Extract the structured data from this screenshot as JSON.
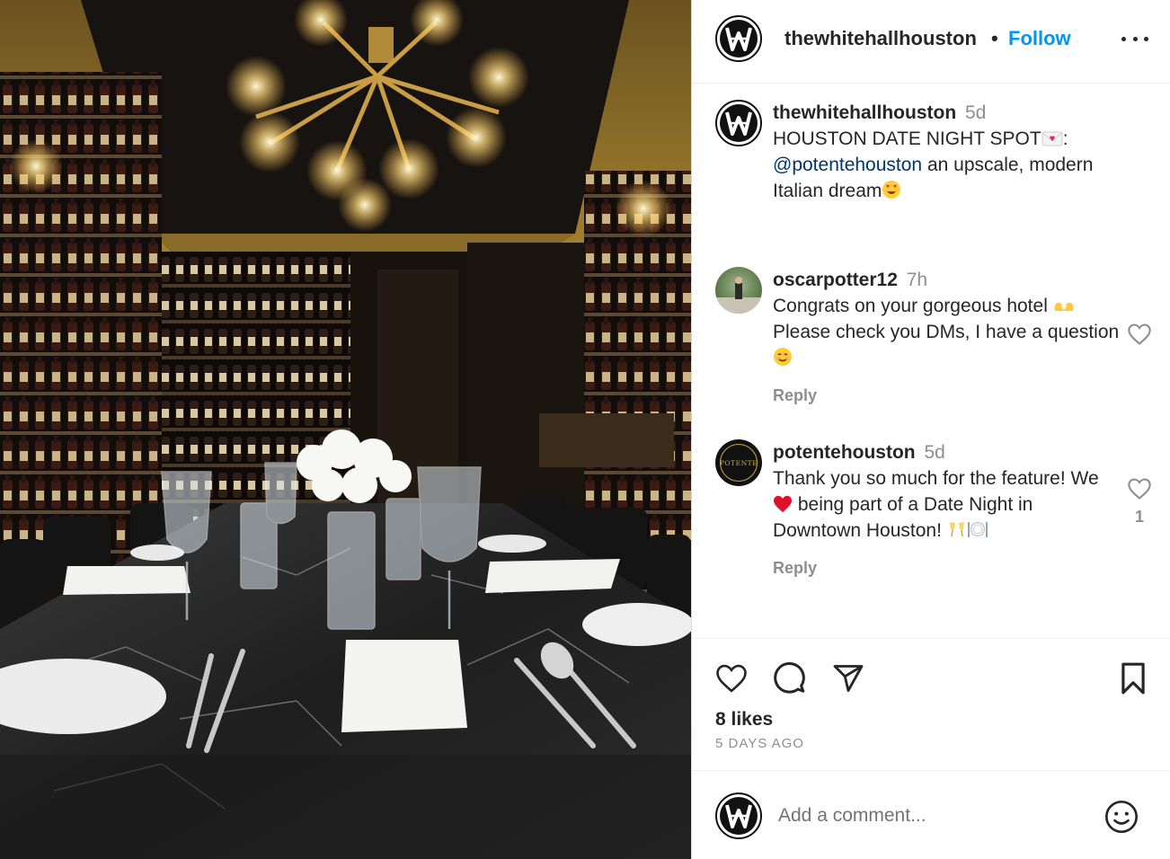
{
  "post": {
    "username": "thewhitehallhouston",
    "separator": "•",
    "follow_label": "Follow",
    "more_label": "More options",
    "image_alt": "Private dining room with wine-bottle walls, chandelier and set marble table"
  },
  "caption": {
    "username": "thewhitehallhouston",
    "time": "5d",
    "line1": "HOUSTON DATE NIGHT SPOT",
    "line1_end": ":",
    "mention": "@potentehouston",
    "rest": " an upscale, modern Italian dream"
  },
  "comments": [
    {
      "username": "oscarpotter12",
      "time": "7h",
      "text_a": "Congrats on your gorgeous hotel ",
      "text_b": " Please check you DMs, I have a question ",
      "reply_label": "Reply",
      "likes": ""
    },
    {
      "username": "potentehouston",
      "avatar_text": "POTENTE",
      "time": "5d",
      "text_a": "Thank you so much for the feature! We ",
      "text_b": " being part of a Date Night in Downtown Houston! ",
      "reply_label": "Reply",
      "likes": "1"
    }
  ],
  "actions": {
    "likes_text": "8 likes",
    "date_text": "5 DAYS AGO"
  },
  "add_comment": {
    "placeholder": "Add a comment..."
  },
  "colors": {
    "follow": "#0095f6",
    "mention": "#00376b",
    "muted": "#8e8e8e",
    "text": "#262626",
    "heart_red": "#e0245e"
  }
}
